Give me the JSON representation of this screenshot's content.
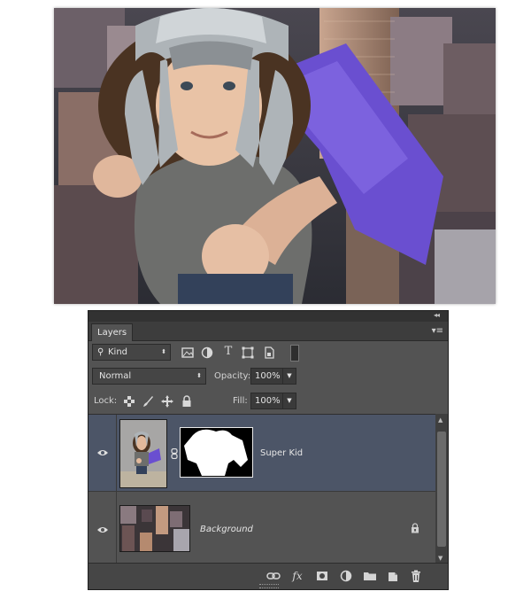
{
  "photo": {
    "icon": "superhero-kid-photo"
  },
  "panel": {
    "tab_label": "Layers",
    "filter": {
      "label": "Kind",
      "icons": [
        "image-filter-icon",
        "adjustment-filter-icon",
        "type-filter-icon",
        "shape-filter-icon",
        "smart-object-filter-icon",
        "filter-toggle-icon"
      ]
    },
    "blend_mode": "Normal",
    "opacity_label": "Opacity:",
    "opacity_value": "100%",
    "lock_label": "Lock:",
    "fill_label": "Fill:",
    "fill_value": "100%",
    "type_filter_glyph": "T",
    "menu_glyph": "▾≡",
    "collapse_glyph": "◂◂",
    "close_glyph": "✕",
    "layers": [
      {
        "name": "Super Kid",
        "selected": true,
        "has_mask": true,
        "linked": true
      },
      {
        "name": "Background",
        "selected": false,
        "locked": true
      }
    ],
    "bottom_icons": [
      "link-layers-icon",
      "fx-icon",
      "add-mask-icon",
      "adjustment-layer-icon",
      "new-group-icon",
      "new-layer-icon",
      "delete-icon"
    ],
    "fx_label": "fx"
  }
}
